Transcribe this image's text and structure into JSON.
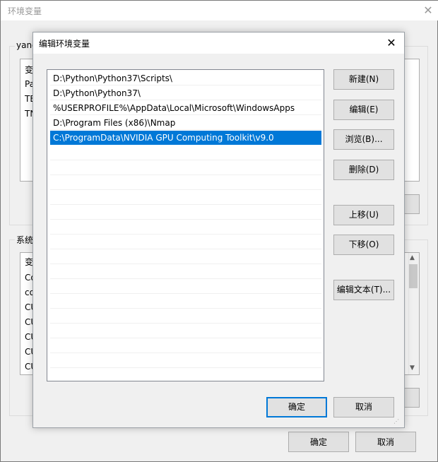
{
  "outer": {
    "title": "环境变量",
    "user_group_label": "yang",
    "user_list_header": "变",
    "user_items": [
      "Pa",
      "TE",
      "TN"
    ],
    "system_group_label": "系统",
    "system_list_header": "变",
    "system_items": [
      "Co",
      "co",
      "CU",
      "CU",
      "CU",
      "CU",
      "CU"
    ],
    "ok_label": "确定",
    "cancel_label": "取消"
  },
  "dialog": {
    "title": "编辑环境变量",
    "paths": [
      "D:\\Python\\Python37\\Scripts\\",
      "D:\\Python\\Python37\\",
      "%USERPROFILE%\\AppData\\Local\\Microsoft\\WindowsApps",
      "D:\\Program Files (x86)\\Nmap",
      "C:\\ProgramData\\NVIDIA GPU Computing Toolkit\\v9.0"
    ],
    "selected_index": 4,
    "buttons": {
      "new": "新建(N)",
      "edit": "编辑(E)",
      "browse": "浏览(B)...",
      "delete": "删除(D)",
      "move_up": "上移(U)",
      "move_down": "下移(O)",
      "edit_text": "编辑文本(T)..."
    },
    "ok_label": "确定",
    "cancel_label": "取消"
  },
  "colors": {
    "selection": "#0078d7",
    "default_button_border": "#0078d7"
  }
}
